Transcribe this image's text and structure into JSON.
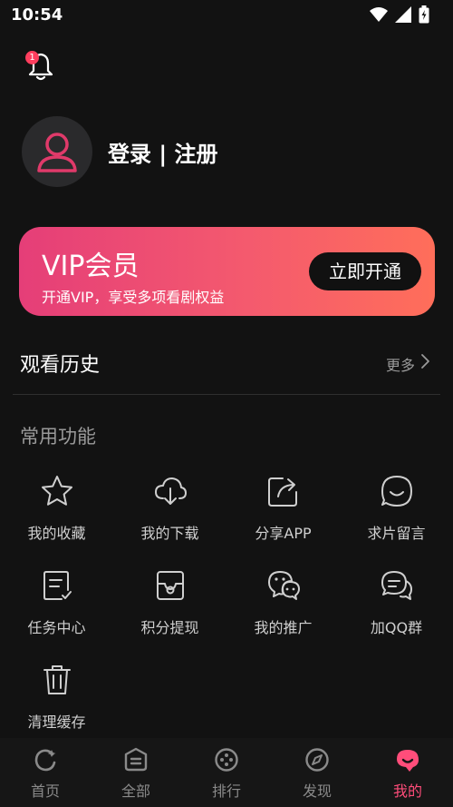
{
  "status_bar": {
    "time": "10:54"
  },
  "notification": {
    "badge_count": "1"
  },
  "profile": {
    "login_text": "登录 | 注册"
  },
  "vip": {
    "title": "VIP会员",
    "subtitle": "开通VIP，享受多项看剧权益",
    "button_label": "立即开通"
  },
  "history": {
    "title": "观看历史",
    "more_label": "更多"
  },
  "functions": {
    "section_title": "常用功能",
    "items": [
      {
        "label": "我的收藏",
        "icon": "star-icon"
      },
      {
        "label": "我的下载",
        "icon": "cloud-download-icon"
      },
      {
        "label": "分享APP",
        "icon": "share-icon"
      },
      {
        "label": "求片留言",
        "icon": "chat-bubble-icon"
      },
      {
        "label": "任务中心",
        "icon": "task-doc-icon"
      },
      {
        "label": "积分提现",
        "icon": "wallet-icon"
      },
      {
        "label": "我的推广",
        "icon": "wechat-icon"
      },
      {
        "label": "加QQ群",
        "icon": "group-chat-icon"
      },
      {
        "label": "清理缓存",
        "icon": "trash-icon"
      }
    ]
  },
  "tabs": [
    {
      "label": "首页",
      "icon": "home-icon",
      "active": false
    },
    {
      "label": "全部",
      "icon": "all-icon",
      "active": false
    },
    {
      "label": "排行",
      "icon": "rank-icon",
      "active": false
    },
    {
      "label": "发现",
      "icon": "compass-icon",
      "active": false
    },
    {
      "label": "我的",
      "icon": "me-icon",
      "active": true
    }
  ],
  "colors": {
    "background": "#121212",
    "accent": "#ff4d7a",
    "vip_gradient_start": "#e53e78",
    "vip_gradient_end": "#ff6e5a"
  }
}
